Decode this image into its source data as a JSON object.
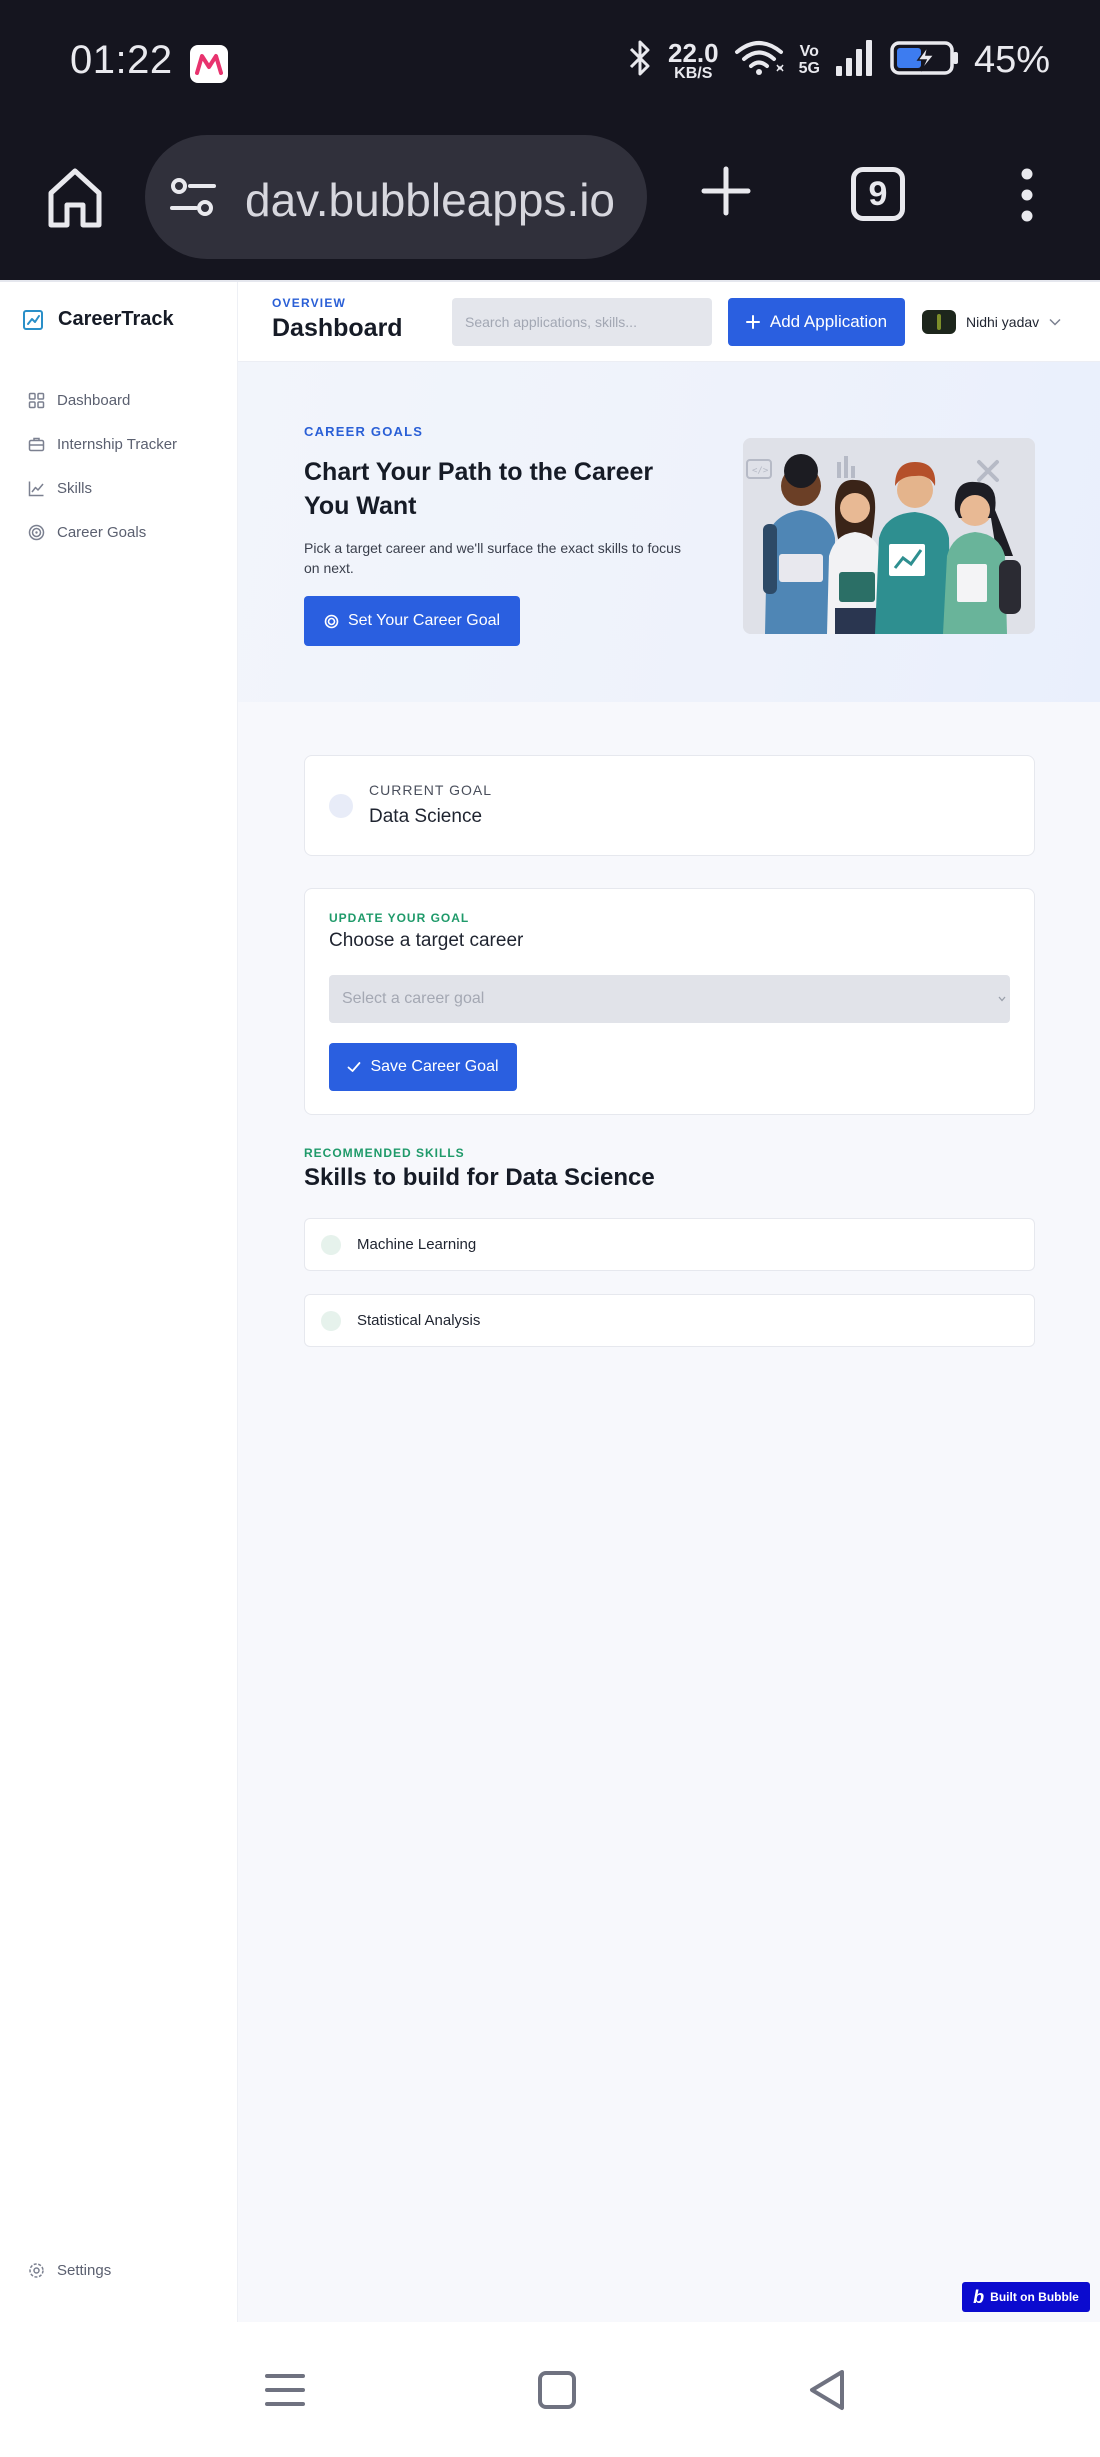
{
  "status_bar": {
    "time": "01:22",
    "net_speed_value": "22.0",
    "net_speed_unit": "KB/S",
    "volte_line1": "Vo",
    "volte_line2": "5G",
    "battery_percent": "45%"
  },
  "browser": {
    "url": "dav.bubbleapps.io",
    "tab_count": "9"
  },
  "sidebar": {
    "brand": "CareerTrack",
    "items": [
      {
        "label": "Dashboard",
        "icon": "grid-icon"
      },
      {
        "label": "Internship Tracker",
        "icon": "briefcase-icon"
      },
      {
        "label": "Skills",
        "icon": "chart-line-icon"
      },
      {
        "label": "Career Goals",
        "icon": "target-icon"
      }
    ],
    "settings_label": "Settings"
  },
  "topbar": {
    "eyebrow": "OVERVIEW",
    "title": "Dashboard",
    "search_placeholder": "Search applications, skills...",
    "add_button": "Add Application",
    "user_name": "Nidhi yadav"
  },
  "hero": {
    "eyebrow": "CAREER GOALS",
    "title": "Chart Your Path to the Career You Want",
    "description": "Pick a target career and we'll surface the exact skills to focus on next.",
    "button": "Set Your Career Goal"
  },
  "current_goal": {
    "label": "CURRENT GOAL",
    "value": "Data Science"
  },
  "update_goal": {
    "eyebrow": "UPDATE YOUR GOAL",
    "title": "Choose a target career",
    "select_placeholder": "Select a career goal",
    "save_button": "Save Career Goal"
  },
  "recommended": {
    "eyebrow": "RECOMMENDED SKILLS",
    "title": "Skills to build for Data Science",
    "skills": [
      {
        "name": "Machine Learning"
      },
      {
        "name": "Statistical Analysis"
      }
    ]
  },
  "badge": {
    "logo": "b",
    "text": "Built on Bubble"
  },
  "colors": {
    "primary": "#2a5fe0",
    "eyebrow_blue": "#2a5fd6",
    "eyebrow_green": "#1f9a6a",
    "bubble_badge": "#0b0bcf",
    "status_bar_bg": "#15151f"
  }
}
